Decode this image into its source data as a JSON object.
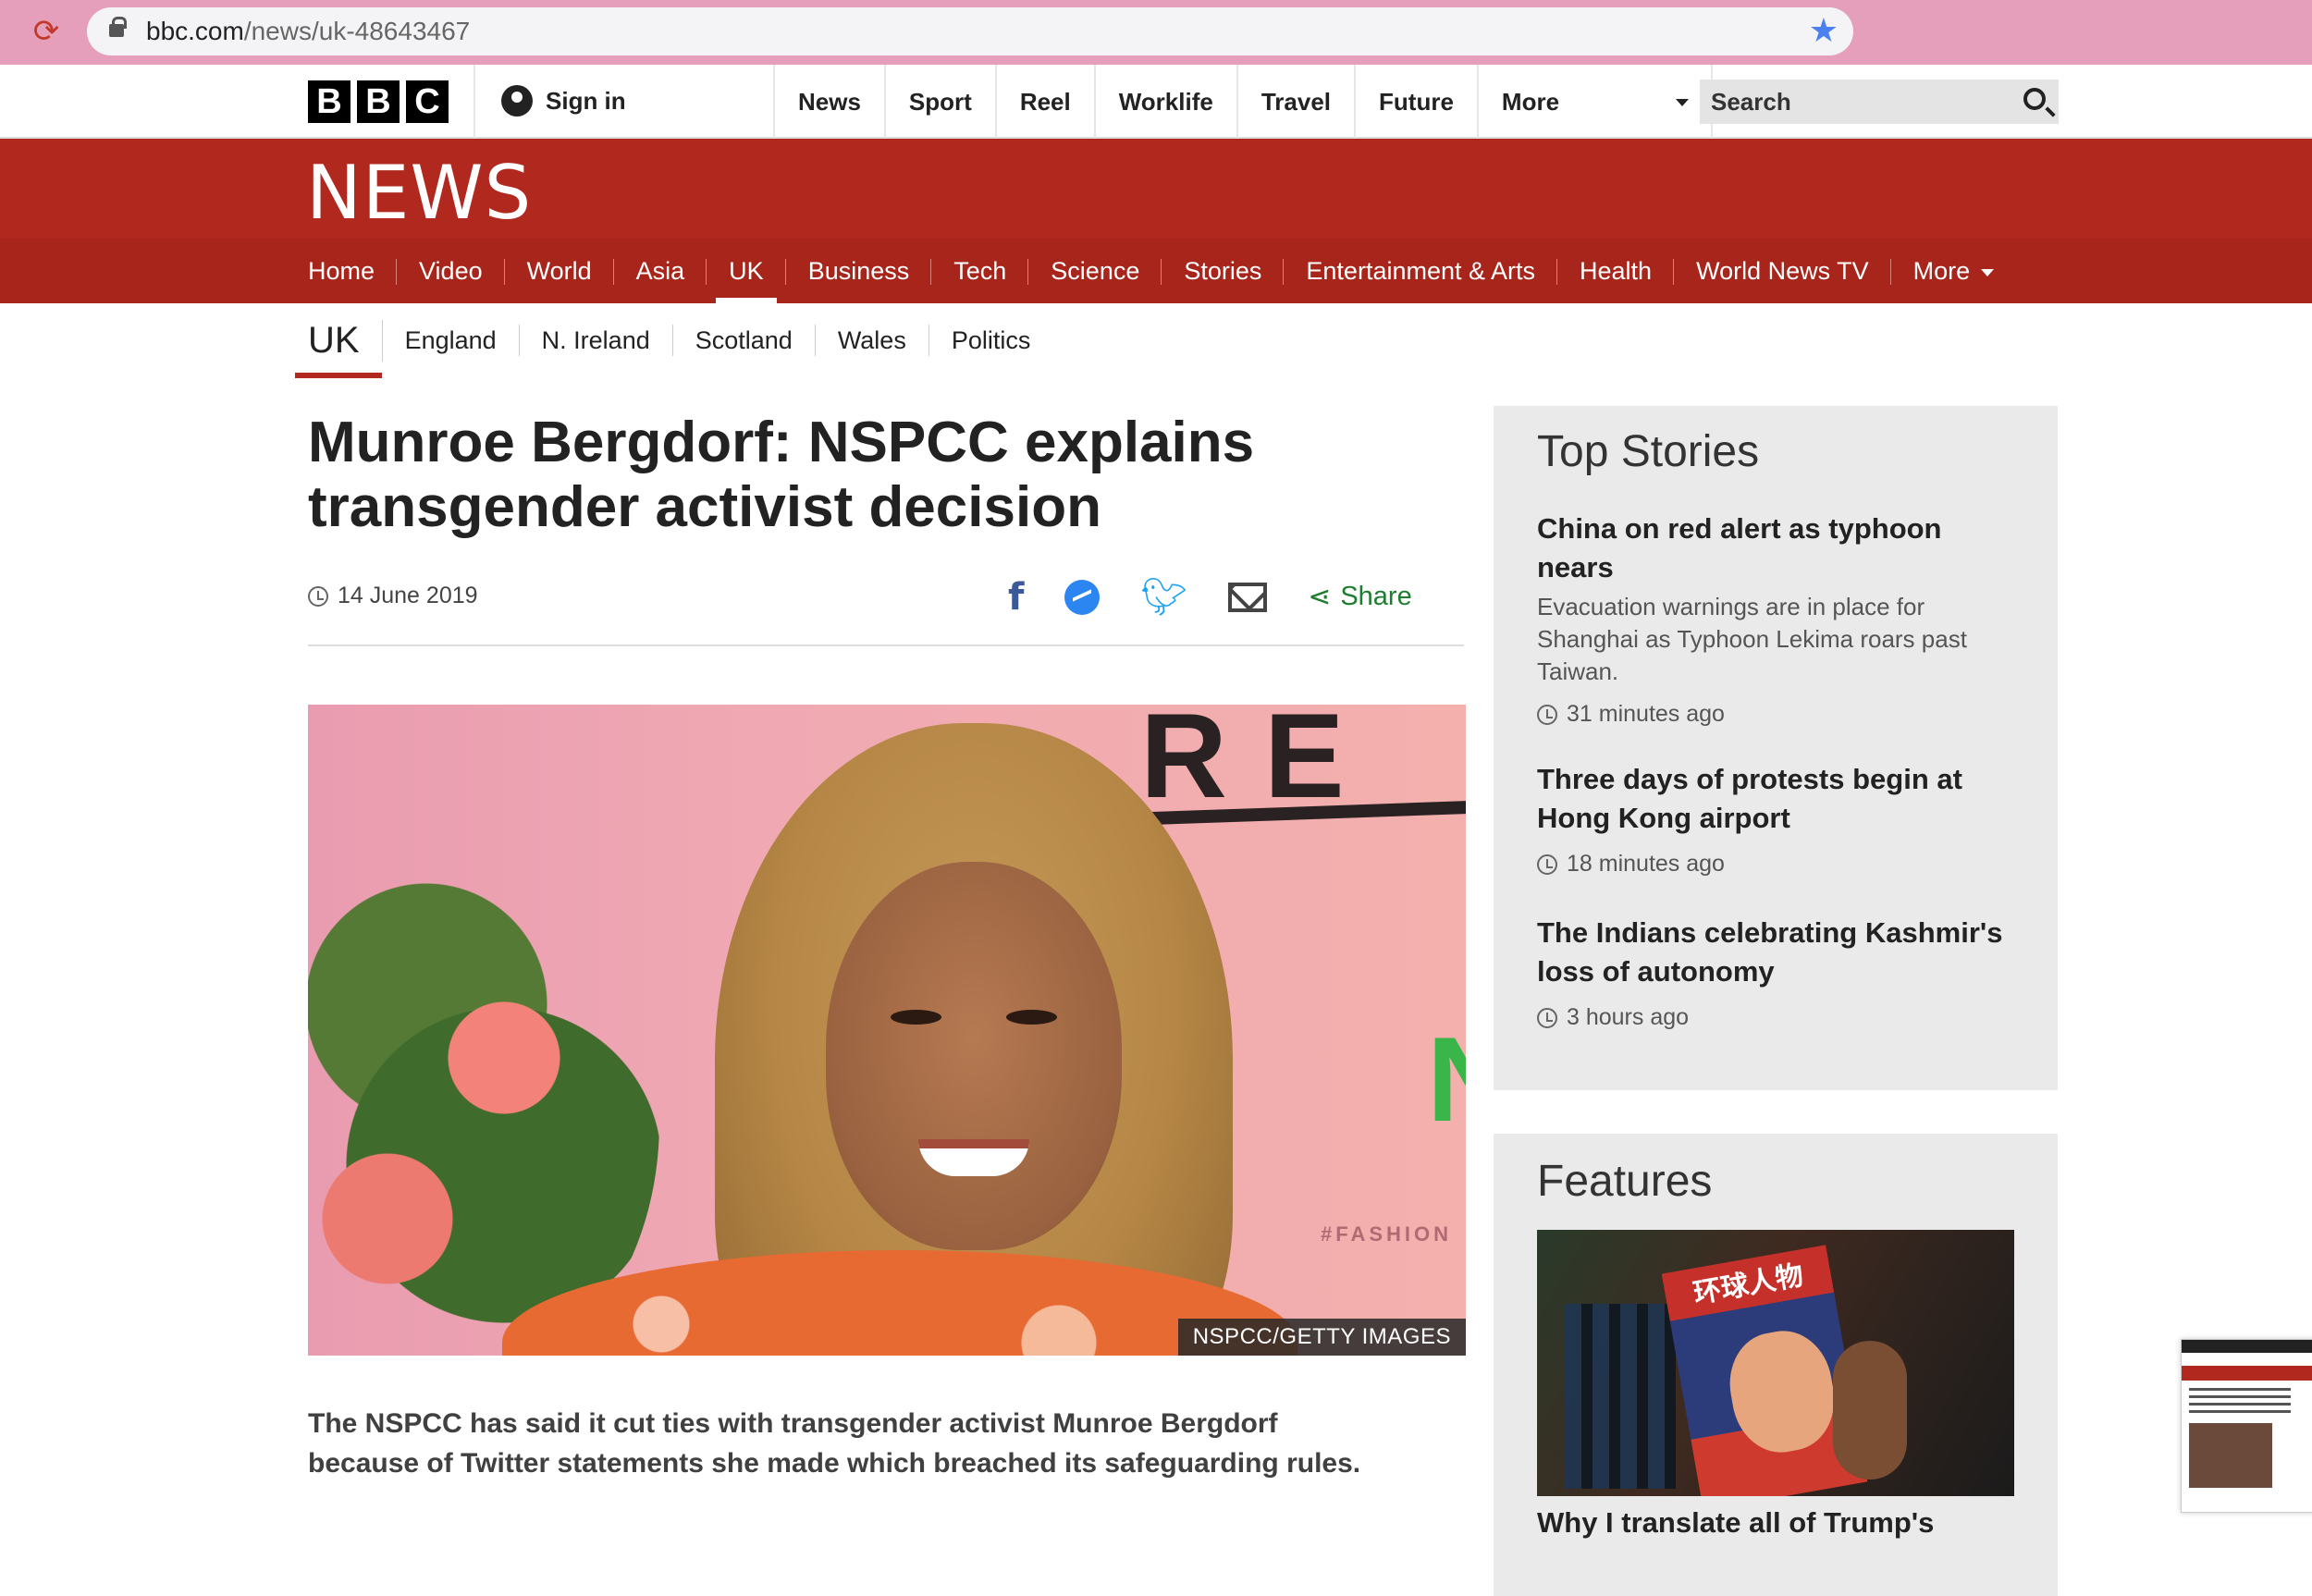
{
  "browser": {
    "url_domain": "bbc.com",
    "url_path": "/news/uk-48643467"
  },
  "masthead": {
    "logo_letters": [
      "B",
      "B",
      "C"
    ],
    "sign_in": "Sign in",
    "nav": [
      "News",
      "Sport",
      "Reel",
      "Worklife",
      "Travel",
      "Future"
    ],
    "more": "More",
    "search_label": "Search"
  },
  "news": {
    "title": "NEWS",
    "sections": [
      "Home",
      "Video",
      "World",
      "Asia",
      "UK",
      "Business",
      "Tech",
      "Science",
      "Stories",
      "Entertainment & Arts",
      "Health",
      "World News TV"
    ],
    "active_section": "UK",
    "more": "More"
  },
  "subnav": {
    "current": "UK",
    "items": [
      "England",
      "N. Ireland",
      "Scotland",
      "Wales",
      "Politics"
    ]
  },
  "article": {
    "headline": "Munroe Bergdorf: NSPCC explains transgender activist decision",
    "date": "14 June 2019",
    "share_label": "Share",
    "image": {
      "caption": "NSPCC/GETTY IMAGES",
      "sign_letters": "RE",
      "sign_letter_right": "N",
      "sign_tag": "#FASHION"
    },
    "intro": "The NSPCC has said it cut ties with transgender activist Munroe Bergdorf because of Twitter statements she made which breached its safeguarding rules."
  },
  "top_stories": {
    "heading": "Top Stories",
    "items": [
      {
        "title": "China on red alert as typhoon nears",
        "summary": "Evacuation warnings are in place for Shanghai as Typhoon Lekima roars past Taiwan.",
        "time": "31 minutes ago"
      },
      {
        "title": "Three days of protests begin at Hong Kong airport",
        "time": "18 minutes ago"
      },
      {
        "title": "The Indians celebrating Kashmir's loss of autonomy",
        "time": "3 hours ago"
      }
    ]
  },
  "features": {
    "heading": "Features",
    "image_text": "环球人物",
    "first_title": "Why I translate all of Trump's"
  },
  "colors": {
    "bbc_red": "#b0281e",
    "chrome_pink": "#e59fba",
    "share_green": "#1f7d30"
  }
}
